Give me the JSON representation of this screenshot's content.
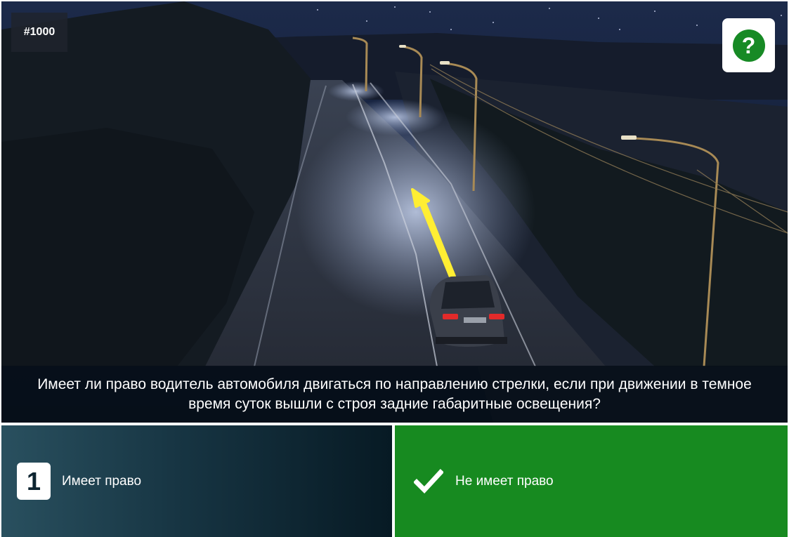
{
  "question_number": "#1000",
  "help_button": {
    "icon": "question-icon",
    "glyph": "?"
  },
  "question_text": "Имеет ли право водитель автомобиля двигаться по направлению стрелки, если при движении в темное время суток вышли с строя задние габаритные освещения?",
  "answers": [
    {
      "number": "1",
      "label": "Имеет право",
      "state": "default"
    },
    {
      "icon": "checkmark-icon",
      "label": "Не имеет право",
      "state": "correct"
    }
  ],
  "colors": {
    "correct_answer_bg": "#178a20",
    "help_icon": "#178a25",
    "arrow": "#ffee33"
  }
}
